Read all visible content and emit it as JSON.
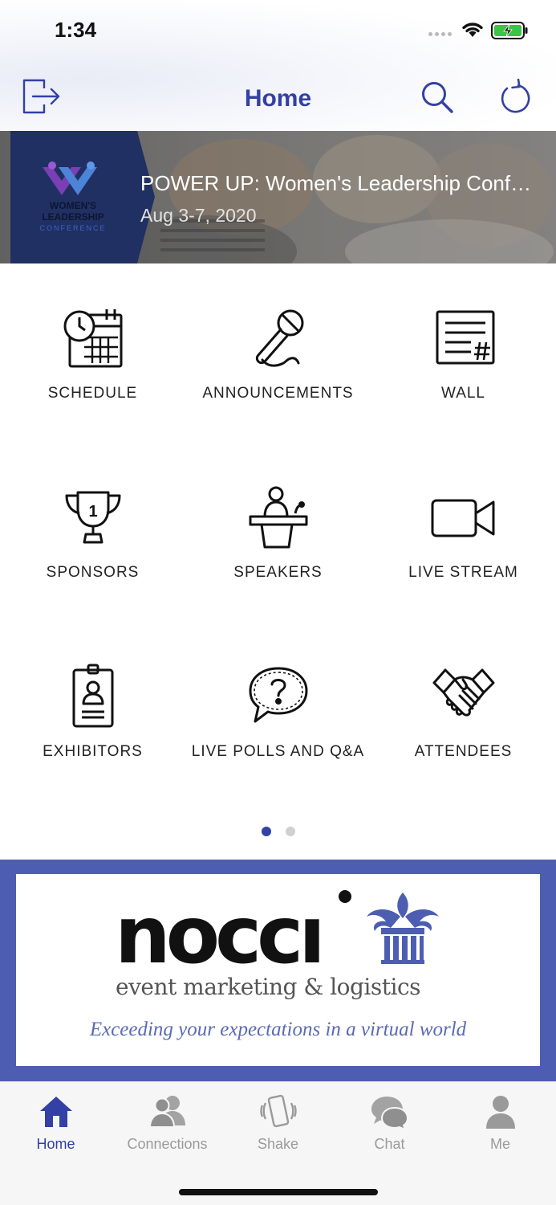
{
  "status_bar": {
    "time": "1:34"
  },
  "nav": {
    "title": "Home"
  },
  "event": {
    "title": "POWER UP: Women's Leadership Conference",
    "date": "Aug 3-7, 2020",
    "logo_text": [
      "WOMEN'S",
      "LEADERSHIP",
      "CONFERENCE"
    ]
  },
  "features": [
    {
      "label": "SCHEDULE",
      "icon": "schedule-icon"
    },
    {
      "label": "ANNOUNCEMENTS",
      "icon": "microphone-icon"
    },
    {
      "label": "WALL",
      "icon": "wall-icon"
    },
    {
      "label": "SPONSORS",
      "icon": "trophy-icon"
    },
    {
      "label": "SPEAKERS",
      "icon": "podium-icon"
    },
    {
      "label": "LIVE STREAM",
      "icon": "video-camera-icon"
    },
    {
      "label": "EXHIBITORS",
      "icon": "badge-icon"
    },
    {
      "label": "LIVE POLLS AND Q&A",
      "icon": "question-bubble-icon"
    },
    {
      "label": "ATTENDEES",
      "icon": "handshake-icon"
    }
  ],
  "pagination": {
    "current": 1,
    "total": 2
  },
  "sponsor": {
    "brand": "nocc",
    "subtitle": "event marketing & logistics",
    "tagline": "Exceeding your expectations in a virtual world"
  },
  "tabs": [
    {
      "label": "Home",
      "icon": "home-icon",
      "active": true
    },
    {
      "label": "Connections",
      "icon": "people-icon",
      "active": false
    },
    {
      "label": "Shake",
      "icon": "phone-shake-icon",
      "active": false
    },
    {
      "label": "Chat",
      "icon": "chat-bubbles-icon",
      "active": false
    },
    {
      "label": "Me",
      "icon": "person-icon",
      "active": false
    }
  ],
  "colors": {
    "accent": "#3340a5",
    "sponsor_bg": "#4d5eb2",
    "dot_active": "#3340a5",
    "dot_inactive": "#d0d0d0",
    "tab_inactive": "#9a9a9a"
  }
}
